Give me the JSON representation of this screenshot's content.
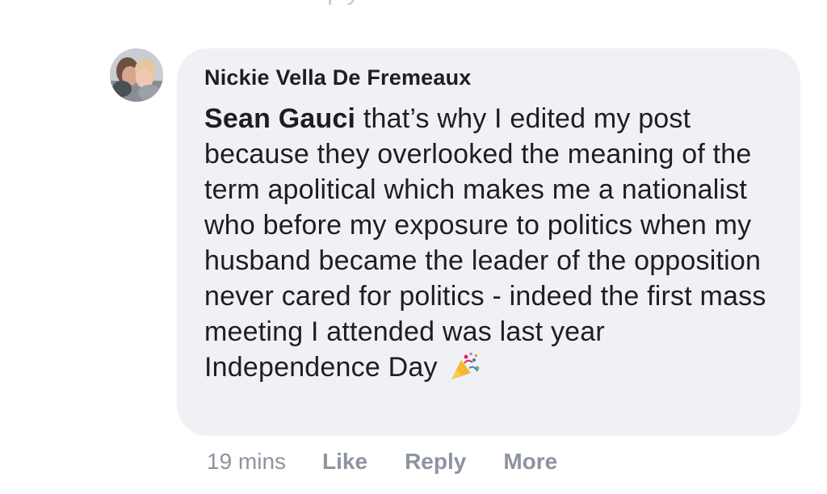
{
  "previous_comment": {
    "partial_text": "· · · ·  ·  ·  Reply  ·  · ·"
  },
  "comment": {
    "author": "Nickie Vella De Fremeaux",
    "mention": "Sean Gauci",
    "text": " that’s why I edited my post because they overlooked the meaning of the term apolitical which makes me a nationalist who before my exposure to politics when my husband became the leader of the opposition never cared for politics - indeed the first mass meeting I attended was last year Independence Day ",
    "emoji_icon": "party-popper-icon",
    "timestamp": "19 mins",
    "actions": {
      "like": "Like",
      "reply": "Reply",
      "more": "More"
    }
  },
  "colors": {
    "bubble_background": "#f0f1f5",
    "text": "#1c1e21",
    "meta_text": "#8d949e"
  }
}
